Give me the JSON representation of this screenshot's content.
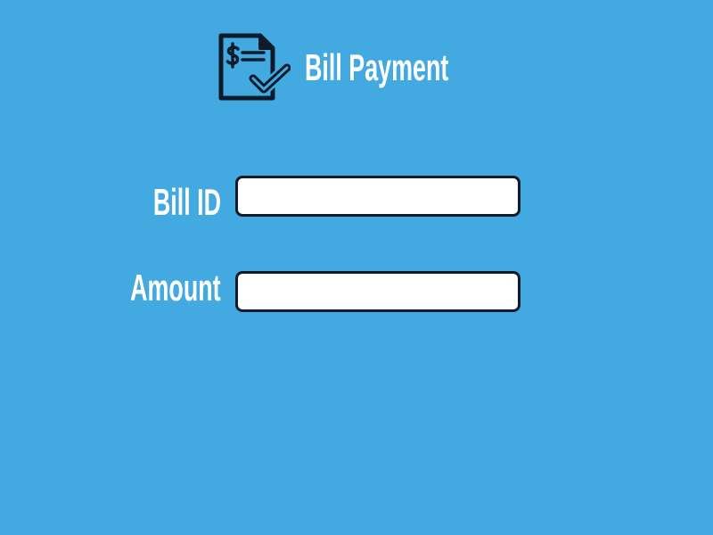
{
  "header": {
    "title": "Bill Payment",
    "icon": "bill-check-icon"
  },
  "form": {
    "fields": [
      {
        "label": "Bill ID",
        "value": "",
        "placeholder": ""
      },
      {
        "label": "Amount",
        "value": "",
        "placeholder": ""
      }
    ]
  },
  "colors": {
    "background": "#42a9e1",
    "text": "#ffffff",
    "input_border": "#0d1b2a",
    "icon_stroke": "#0d1b2a"
  }
}
